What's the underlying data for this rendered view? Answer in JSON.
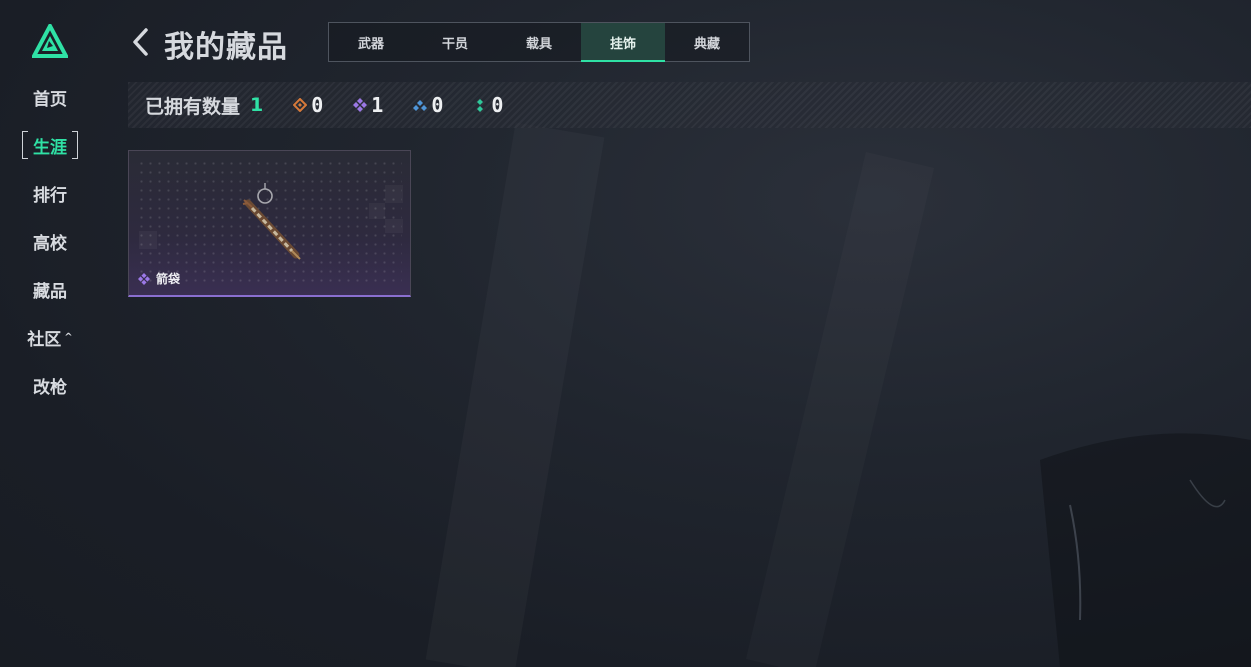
{
  "colors": {
    "accent": "#2fe1a5",
    "purple": "#8a6fd0"
  },
  "sidebar": {
    "logo_icon": "triangle-logo-icon",
    "items": [
      {
        "label": "首页"
      },
      {
        "label": "生涯",
        "active": true
      },
      {
        "label": "排行"
      },
      {
        "label": "高校"
      },
      {
        "label": "藏品"
      },
      {
        "label": "社区",
        "caret": "^"
      },
      {
        "label": "改枪"
      }
    ]
  },
  "header": {
    "back_icon": "chevron-left-icon",
    "title": "我的藏品",
    "tabs": [
      {
        "label": "武器"
      },
      {
        "label": "干员"
      },
      {
        "label": "载具"
      },
      {
        "label": "挂饰",
        "active": true
      },
      {
        "label": "典藏"
      }
    ]
  },
  "stats": {
    "owned_label": "已拥有数量",
    "owned_count": "1",
    "rarities": [
      {
        "icon": "orange-diamond-icon",
        "color": "#d77a3a",
        "count": "0"
      },
      {
        "icon": "purple-gem-icon",
        "color": "#9b78e6",
        "count": "1"
      },
      {
        "icon": "blue-gem-icon",
        "color": "#4f95d8",
        "count": "0"
      },
      {
        "icon": "green-gem-icon",
        "color": "#2fc79a",
        "count": "0"
      }
    ]
  },
  "items": [
    {
      "name": "箭袋",
      "rarity_icon": "purple-gem-icon",
      "image_icon": "quiver-charm-icon"
    }
  ]
}
